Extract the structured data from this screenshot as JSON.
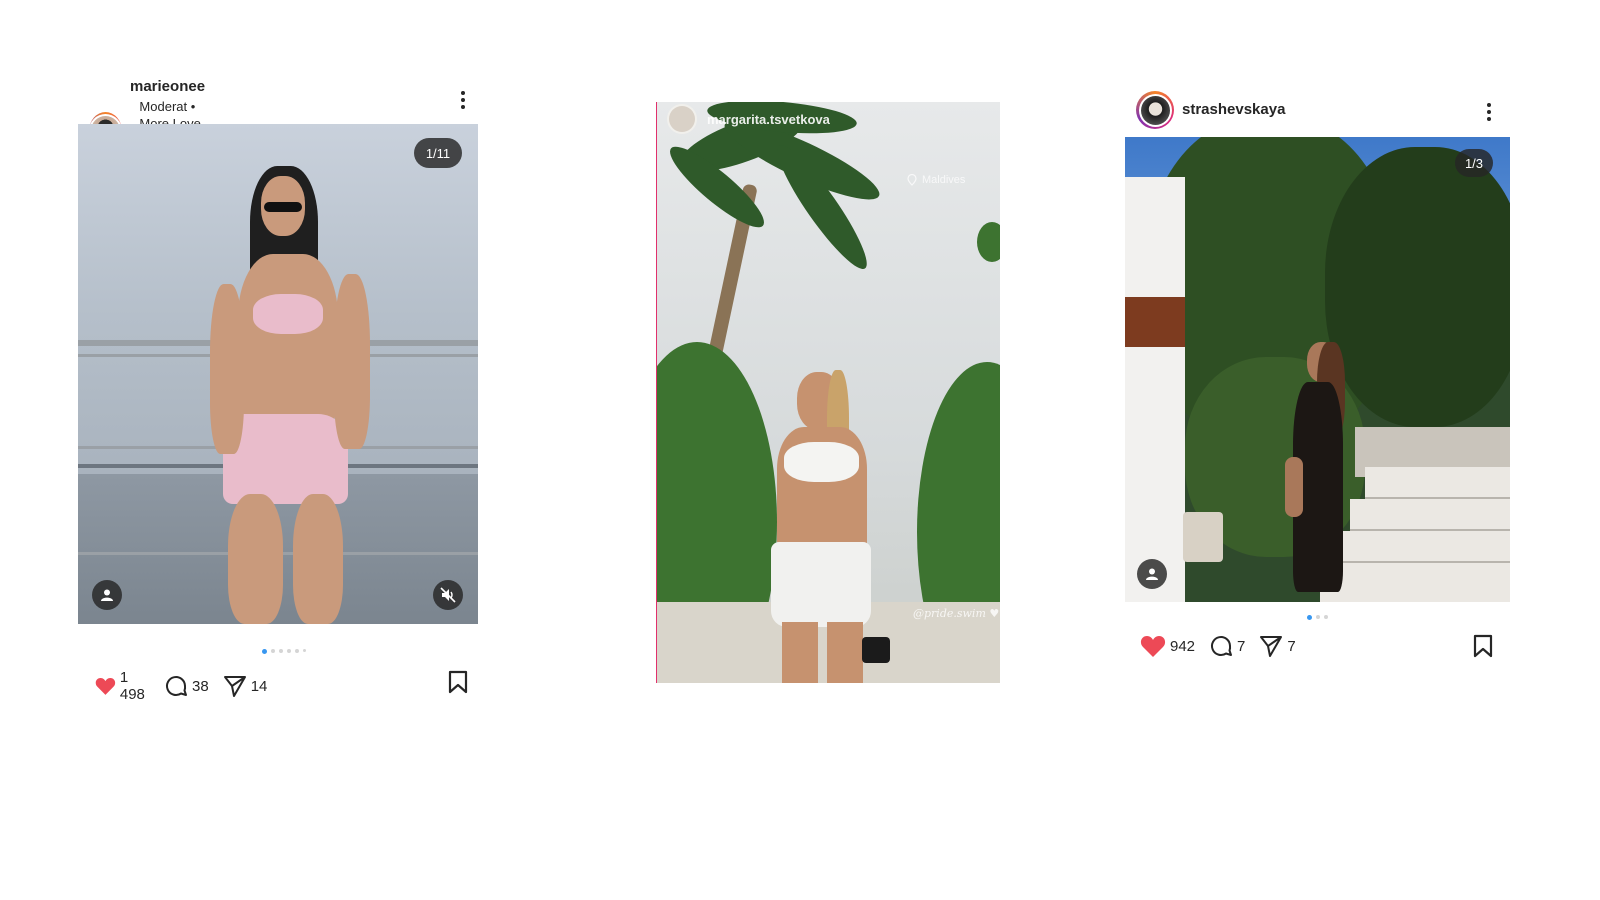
{
  "posts": [
    {
      "username": "marieonee",
      "song": "Moderat • More Love (Rampa &ME Remix)",
      "counter": "1/11",
      "likes": "1 498",
      "comments": "38",
      "shares": "14",
      "carousel_total": 6,
      "carousel_index": 1
    },
    {
      "username": "margarita.tsvetkova",
      "location": "Maldives",
      "sticker": "@pride.swim ♥"
    },
    {
      "username": "strashevskaya",
      "counter": "1/3",
      "likes": "942",
      "comments": "7",
      "shares": "7",
      "carousel_total": 3,
      "carousel_index": 1
    }
  ],
  "colors": {
    "like_red": "#ed4956",
    "dot_active": "#3897f0",
    "text": "#262626",
    "story_border": "#e1306c"
  },
  "icons": [
    "heart-icon",
    "comment-icon",
    "share-icon",
    "bookmark-icon",
    "more-icon",
    "music-icon",
    "user-tag-icon",
    "mute-icon",
    "location-icon"
  ]
}
